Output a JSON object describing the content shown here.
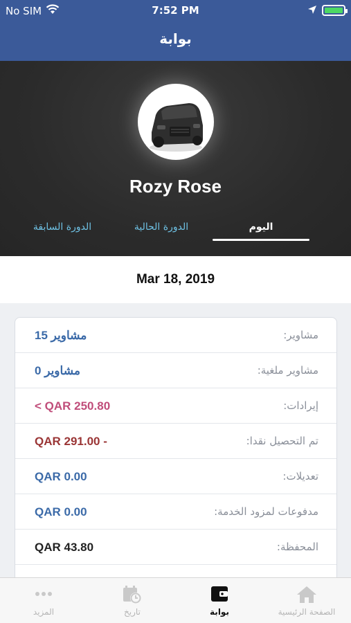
{
  "status_bar": {
    "carrier": "No SIM",
    "time": "7:52 PM"
  },
  "header": {
    "title": "بوابة"
  },
  "profile": {
    "name": "Rozy Rose",
    "tabs": [
      {
        "label": "اليوم",
        "active": true
      },
      {
        "label": "الدورة الحالية",
        "active": false
      },
      {
        "label": "الدورة السابقة",
        "active": false
      }
    ]
  },
  "date": "Mar 18, 2019",
  "rows": [
    {
      "label": "مشاوير:",
      "value": "15 مشاوير",
      "color": "#3b6aa8"
    },
    {
      "label": "مشاوير ملغية:",
      "value": "0 مشاوير",
      "color": "#3b6aa8"
    },
    {
      "label": "إيرادات:",
      "value": "< QAR 250.80",
      "color": "#c04d7a"
    },
    {
      "label": "تم التحصيل نقدا:",
      "value": "QAR 291.00 -",
      "color": "#9a3535"
    },
    {
      "label": "تعديلات:",
      "value": "QAR 0.00",
      "color": "#3b6aa8"
    },
    {
      "label": "مدفوعات لمزود الخدمة:",
      "value": "QAR 0.00",
      "color": "#3b6aa8"
    },
    {
      "label": "المحفظة:",
      "value": "QAR 43.80",
      "color": "#222222"
    }
  ],
  "tabbar": [
    {
      "label": "الصفحة الرئيسية",
      "icon": "home-icon",
      "active": false
    },
    {
      "label": "بوابة",
      "icon": "wallet-icon",
      "active": true
    },
    {
      "label": "تاريخ",
      "icon": "calendar-clock-icon",
      "active": false
    },
    {
      "label": "المزيد",
      "icon": "more-dots-icon",
      "active": false
    }
  ],
  "colors": {
    "header": "#3b5a99",
    "profile_bg": "#2b2b2b",
    "tab_inactive": "#6ec1e4"
  }
}
